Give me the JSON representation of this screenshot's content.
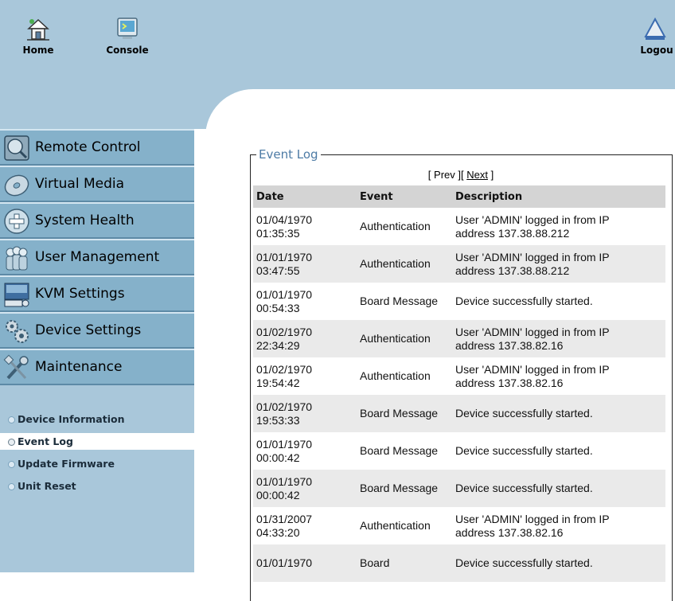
{
  "toolbar": {
    "home_label": "Home",
    "console_label": "Console",
    "logout_label": "Logou"
  },
  "sidebar": {
    "items": [
      {
        "label": "Remote Control",
        "icon": "monitor-icon"
      },
      {
        "label": "Virtual Media",
        "icon": "disc-icon"
      },
      {
        "label": "System Health",
        "icon": "health-cross-icon"
      },
      {
        "label": "User Management",
        "icon": "users-icon"
      },
      {
        "label": "KVM Settings",
        "icon": "kvm-keyboard-icon"
      },
      {
        "label": "Device Settings",
        "icon": "gears-icon"
      },
      {
        "label": "Maintenance",
        "icon": "tools-icon"
      }
    ],
    "subitems": [
      {
        "label": "Device Information",
        "active": false
      },
      {
        "label": "Event Log",
        "active": true
      },
      {
        "label": "Update Firmware",
        "active": false
      },
      {
        "label": "Unit Reset",
        "active": false
      }
    ]
  },
  "event_log": {
    "title": "Event Log",
    "pager": {
      "prev": "Prev",
      "next": "Next"
    },
    "columns": [
      "Date",
      "Event",
      "Description"
    ],
    "rows": [
      {
        "date": "01/04/1970",
        "time": "01:35:35",
        "event": "Authentication",
        "desc1": "User 'ADMIN' logged in from IP",
        "desc2": "address 137.38.88.212"
      },
      {
        "date": "01/01/1970",
        "time": "03:47:55",
        "event": "Authentication",
        "desc1": "User 'ADMIN' logged in from IP",
        "desc2": "address 137.38.88.212"
      },
      {
        "date": "01/01/1970",
        "time": "00:54:33",
        "event": "Board Message",
        "desc1": "Device successfully started.",
        "desc2": ""
      },
      {
        "date": "01/02/1970",
        "time": "22:34:29",
        "event": "Authentication",
        "desc1": "User 'ADMIN' logged in from IP",
        "desc2": "address 137.38.82.16"
      },
      {
        "date": "01/02/1970",
        "time": "19:54:42",
        "event": "Authentication",
        "desc1": "User 'ADMIN' logged in from IP",
        "desc2": "address 137.38.82.16"
      },
      {
        "date": "01/02/1970",
        "time": "19:53:33",
        "event": "Board Message",
        "desc1": "Device successfully started.",
        "desc2": ""
      },
      {
        "date": "01/01/1970",
        "time": "00:00:42",
        "event": "Board Message",
        "desc1": "Device successfully started.",
        "desc2": ""
      },
      {
        "date": "01/01/1970",
        "time": "00:00:42",
        "event": "Board Message",
        "desc1": "Device successfully started.",
        "desc2": ""
      },
      {
        "date": "01/31/2007",
        "time": "04:33:20",
        "event": "Authentication",
        "desc1": "User 'ADMIN' logged in from IP",
        "desc2": "address 137.38.82.16"
      },
      {
        "date": "01/01/1970",
        "time": "",
        "event": "Board",
        "desc1": "Device successfully started.",
        "desc2": ""
      }
    ]
  },
  "colors": {
    "chrome_blue": "#a9c7da",
    "nav_button": "#85b1ca",
    "title_blue": "#4d7ba5",
    "header_gray": "#d4d4d4",
    "row_alt": "#eaeaea"
  }
}
